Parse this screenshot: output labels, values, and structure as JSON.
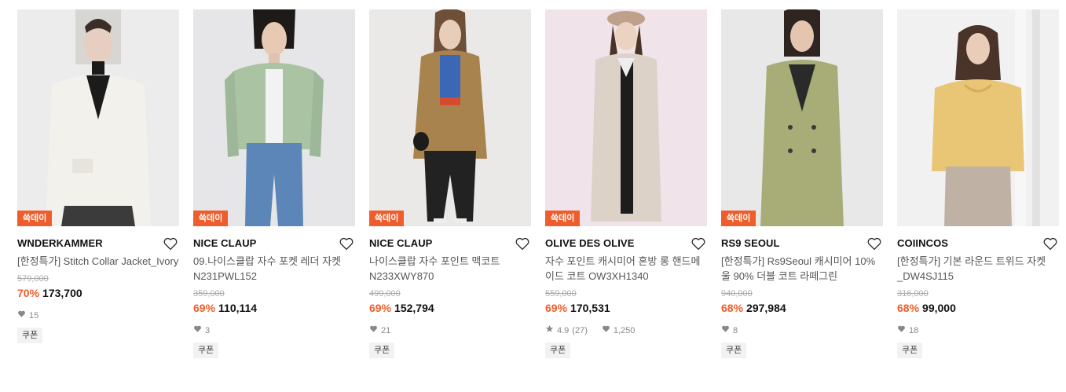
{
  "products": [
    {
      "badge": "쓱데이",
      "brand": "WNDERKAMMER",
      "name": "[한정특가] Stitch Collar Jacket_Ivory",
      "original_price": "579,000",
      "discount": "70%",
      "price": "173,700",
      "likes": "15",
      "rating": "",
      "reviews": "",
      "coupon": "쿠폰",
      "bg_color": "#ececec",
      "garment_color": "#f3f1ec"
    },
    {
      "badge": "쓱데이",
      "brand": "NICE CLAUP",
      "name": "09.나이스클랍 자수 포켓 레더 자켓 N231PWL152",
      "original_price": "359,000",
      "discount": "69%",
      "price": "110,114",
      "likes": "3",
      "rating": "",
      "reviews": "",
      "coupon": "쿠폰",
      "bg_color": "#e6e6e8",
      "garment_color": "#a9c3a3"
    },
    {
      "badge": "쓱데이",
      "brand": "NICE CLAUP",
      "name": "나이스클랍 자수 포인트 맥코트 N233XWY870",
      "original_price": "499,000",
      "discount": "69%",
      "price": "152,794",
      "likes": "21",
      "rating": "",
      "reviews": "",
      "coupon": "쿠폰",
      "bg_color": "#ebe9e7",
      "garment_color": "#a8834e"
    },
    {
      "badge": "쓱데이",
      "brand": "OLIVE DES OLIVE",
      "name": "자수 포인트 캐시미어 혼방 롱 핸드메이드 코트 OW3XH1340",
      "original_price": "559,000",
      "discount": "69%",
      "price": "170,531",
      "likes": "1,250",
      "rating": "4.9",
      "reviews": "(27)",
      "coupon": "쿠폰",
      "bg_color": "#f0e4ea",
      "garment_color": "#ddd2c7"
    },
    {
      "badge": "쓱데이",
      "brand": "RS9 SEOUL",
      "name": "[한정특가] Rs9Seoul 캐시미어 10% 울 90% 더블 코트 라떼그린",
      "original_price": "940,000",
      "discount": "68%",
      "price": "297,984",
      "likes": "8",
      "rating": "",
      "reviews": "",
      "coupon": "쿠폰",
      "bg_color": "#e8e8e8",
      "garment_color": "#a8ad78"
    },
    {
      "badge": "",
      "brand": "COIINCOS",
      "name": "[한정특가] 기본 라운드 트위드 자켓 _DW4SJ115",
      "original_price": "316,000",
      "discount": "68%",
      "price": "99,000",
      "likes": "18",
      "rating": "",
      "reviews": "",
      "coupon": "쿠폰",
      "bg_color": "#f1f1f1",
      "garment_color": "#e8c676"
    }
  ],
  "icons": {
    "wishlist": "heart-outline-icon",
    "likes": "heart-icon",
    "rating": "star-icon"
  },
  "colors": {
    "accent": "#ef5d2c",
    "brand_text": "#111111",
    "muted": "#888888"
  }
}
